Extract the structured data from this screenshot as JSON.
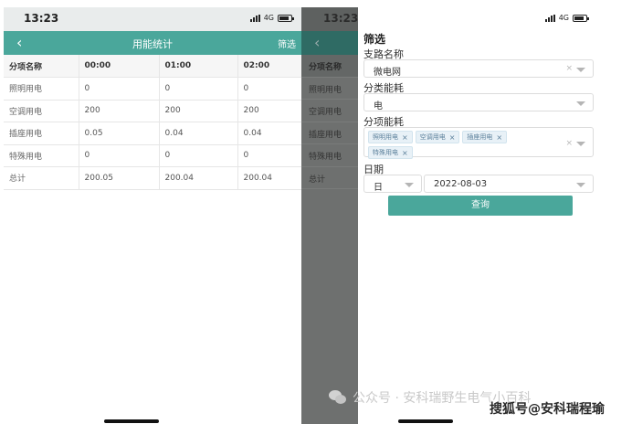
{
  "left_phone": {
    "status": {
      "time": "13:23",
      "network": "4G"
    },
    "nav": {
      "back_icon": "chevron-left-icon",
      "title": "用能统计",
      "filter": "筛选"
    },
    "table": {
      "headers": [
        "分项名称",
        "00:00",
        "01:00",
        "02:00"
      ],
      "rows": [
        [
          "照明用电",
          "0",
          "0",
          "0"
        ],
        [
          "空调用电",
          "200",
          "200",
          "200"
        ],
        [
          "插座用电",
          "0.05",
          "0.04",
          "0.04"
        ],
        [
          "特殊用电",
          "0",
          "0",
          "0"
        ],
        [
          "总计",
          "200.05",
          "200.04",
          "200.04"
        ]
      ]
    }
  },
  "right_phone": {
    "status": {
      "time": "13:23",
      "network": "4G"
    },
    "dim_table": {
      "headers": [
        "分项名称"
      ],
      "rows": [
        "照明用电",
        "空调用电",
        "插座用电",
        "特殊用电",
        "总计"
      ]
    },
    "drawer": {
      "title": "筛选",
      "branch_label": "支路名称",
      "branch_value": "微电网",
      "category_label": "分类能耗",
      "category_value": "电",
      "item_label": "分项能耗",
      "item_tags": [
        "照明用电",
        "空调用电",
        "插座用电",
        "特殊用电"
      ],
      "date_label": "日期",
      "date_unit": "日",
      "date_value": "2022-08-03",
      "query_button": "查询",
      "clear_glyph": "× ▾",
      "tag_close": "×"
    }
  },
  "watermarks": {
    "wechat": "公众号 · 安科瑞野生电气小百科",
    "sohu": "搜狐号@安科瑞程瑜"
  },
  "colors": {
    "accent": "#4aa79b",
    "overlay": "#6e706f"
  }
}
